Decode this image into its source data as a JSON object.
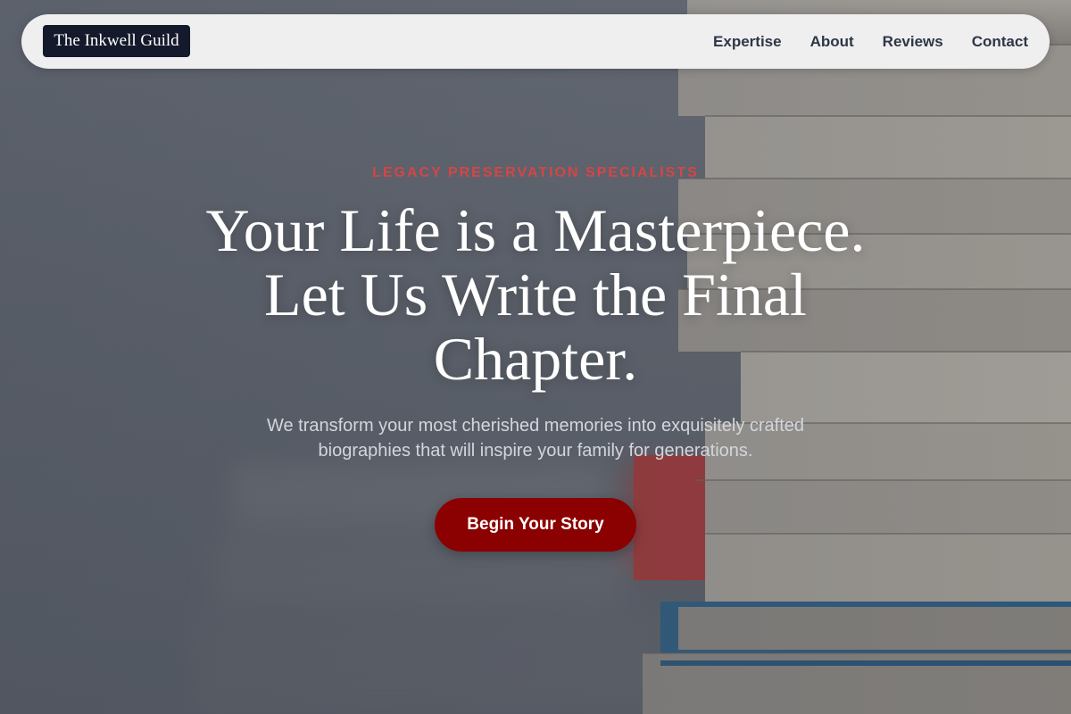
{
  "nav": {
    "logo": "The Inkwell Guild",
    "links": [
      "Expertise",
      "About",
      "Reviews",
      "Contact"
    ]
  },
  "hero": {
    "eyebrow": "LEGACY PRESERVATION SPECIALISTS",
    "headline": [
      "Your Life is a Masterpiece.",
      "Let Us Write the Final",
      "Chapter."
    ],
    "subtext": [
      "We transform your most cherished memories into exquisitely crafted",
      "biographies that will inspire your family for generations."
    ],
    "cta_label": "Begin Your Story"
  },
  "colors": {
    "accent": "#d64545",
    "cta": "#8b0000",
    "logo_bg": "#141a2b",
    "nav_bg": "#efefef"
  }
}
